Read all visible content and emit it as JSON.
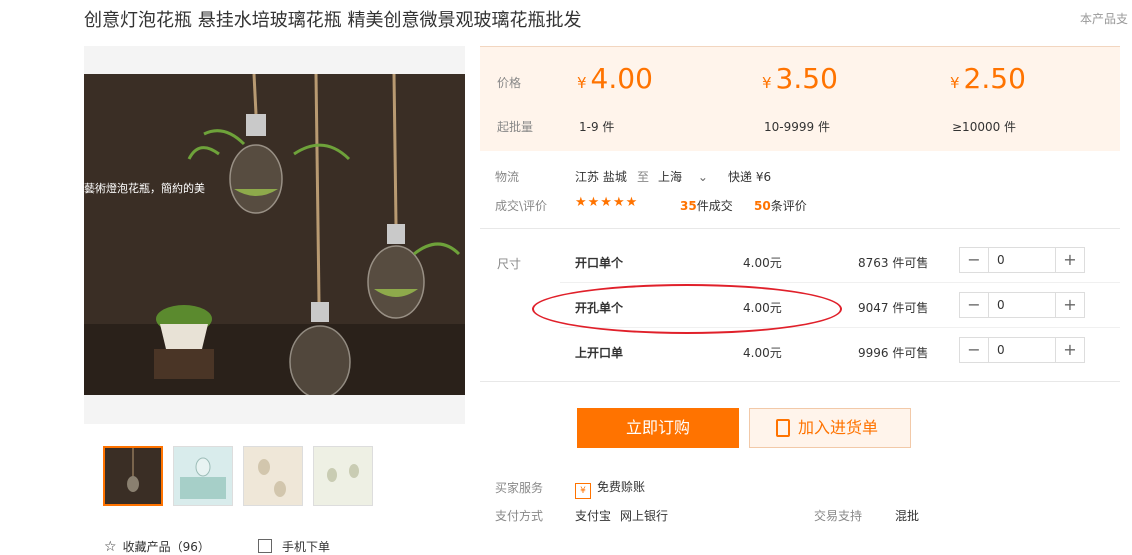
{
  "title": "创意灯泡花瓶 悬挂水培玻璃花瓶 精美创意微景观玻璃花瓶批发",
  "support_note": "本产品支",
  "gallery": {
    "photo_caption": "藝術燈泡花瓶，簡約的美",
    "favorite_label": "收藏产品（96）",
    "mobile_label": "手机下单"
  },
  "price_panel": {
    "price_label": "价格",
    "moq_label": "起批量",
    "currency": "¥",
    "tiers": [
      {
        "price": "4.00",
        "range": "1-9 件"
      },
      {
        "price": "3.50",
        "range": "10-9999 件"
      },
      {
        "price": "2.50",
        "range": "≥10000 件"
      }
    ]
  },
  "logistics": {
    "label": "物流",
    "from": "江苏 盐城",
    "to_word": "至",
    "to": "上海",
    "shipping": "快递 ¥6"
  },
  "reviews": {
    "label": "成交\\评价",
    "stars": "★★★★★",
    "deals_count": "35",
    "deals_suffix": "件成交",
    "reviews_count": "50",
    "reviews_suffix": "条评价"
  },
  "sku": {
    "label": "尺寸",
    "rows": [
      {
        "name": "开口单个",
        "price": "4.00元",
        "stock": "8763 件可售",
        "qty": "0"
      },
      {
        "name": "开孔单个",
        "price": "4.00元",
        "stock": "9047 件可售",
        "qty": "0"
      },
      {
        "name": "上开口单",
        "price": "4.00元",
        "stock": "9996 件可售",
        "qty": "0"
      }
    ]
  },
  "actions": {
    "buy_label": "立即订购",
    "cart_label": "加入进货单"
  },
  "services": {
    "buyer_label": "买家服务",
    "buyer_value": "免费赊账",
    "payment_label": "支付方式",
    "payment_values": [
      "支付宝",
      "网上银行"
    ],
    "trade_label": "交易支持",
    "trade_value": "混批"
  },
  "colors": {
    "accent": "#ff7300",
    "panel_bg": "#fff4eb",
    "annotation": "#e0202a"
  }
}
